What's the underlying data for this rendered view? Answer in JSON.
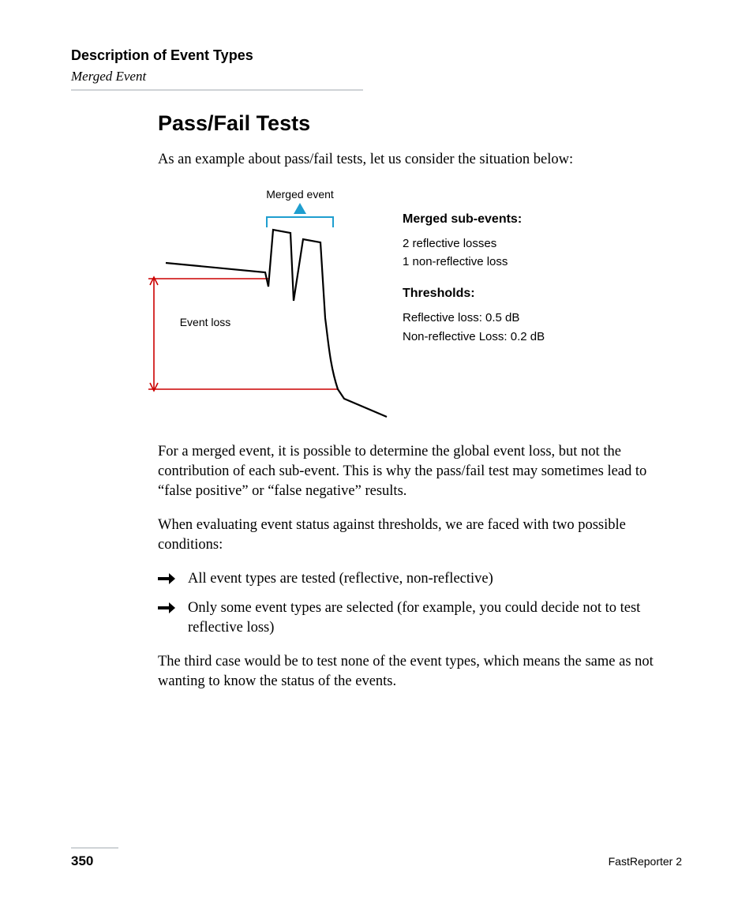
{
  "header": {
    "title": "Description of Event Types",
    "subtitle": "Merged Event"
  },
  "section": {
    "heading": "Pass/Fail Tests",
    "intro": "As an example about pass/fail tests, let us consider the situation below:"
  },
  "diagram": {
    "merged_label": "Merged event",
    "event_loss_label": "Event loss"
  },
  "sidebox": {
    "merged_heading": "Merged sub-events:",
    "merged_lines": [
      "2 reflective losses",
      "1 non-reflective loss"
    ],
    "thresholds_heading": "Thresholds:",
    "threshold_lines": [
      "Reflective loss: 0.5 dB",
      "Non-reflective Loss: 0.2 dB"
    ]
  },
  "paragraphs": {
    "p1": "For a merged event, it is possible to determine the global event loss, but not the contribution of each sub-event. This is why the pass/fail test may sometimes lead to “false positive” or “false negative” results.",
    "p2": "When evaluating event status against thresholds, we are faced with two possible conditions:",
    "p3": "The third case would be to test none of the event types, which means the same as not wanting to know the status of the events."
  },
  "bullets": [
    "All event types are tested (reflective, non-reflective)",
    "Only some event types are selected (for example, you could decide not to test reflective loss)"
  ],
  "footer": {
    "page": "350",
    "doc": "FastReporter 2"
  }
}
